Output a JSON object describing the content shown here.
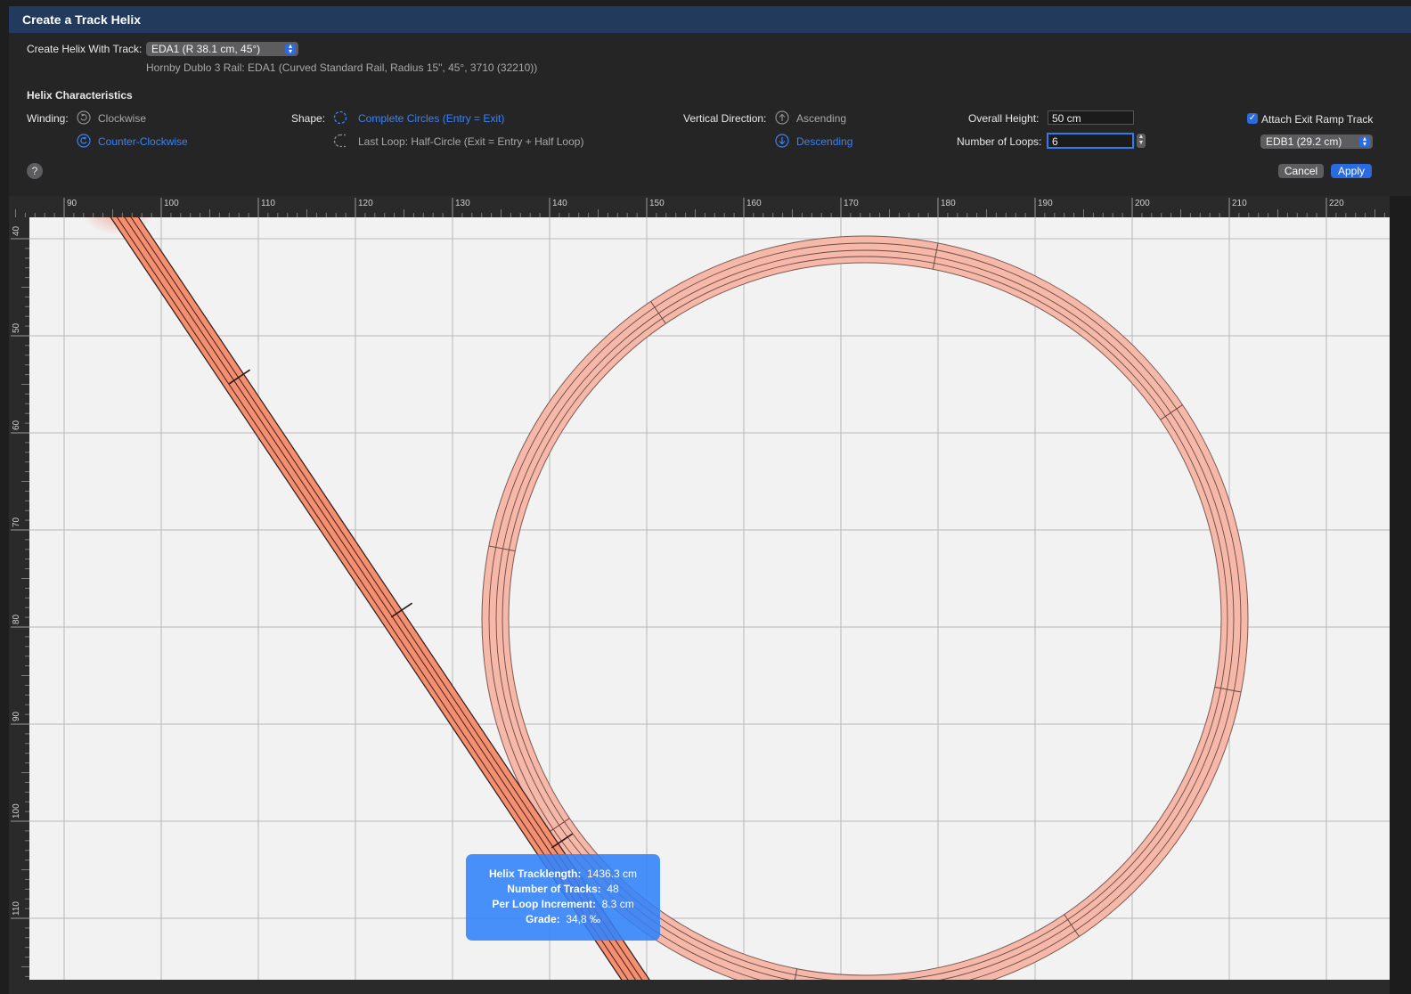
{
  "window": {
    "title": "Create a Track Helix"
  },
  "track": {
    "label": "Create Helix With Track:",
    "selected": "EDA1 (R 38.1 cm, 45°)",
    "description": "Hornby Dublo 3 Rail: EDA1  (Curved Standard Rail, Radius 15\", 45°, 3710 (32210))"
  },
  "helix": {
    "heading": "Helix Characteristics",
    "winding_label": "Winding:",
    "winding_clockwise": "Clockwise",
    "winding_counter": "Counter-Clockwise",
    "winding_selected": "Counter-Clockwise",
    "shape_label": "Shape:",
    "shape_complete": "Complete Circles (Entry = Exit)",
    "shape_half": "Last Loop: Half-Circle (Exit = Entry + Half Loop)",
    "shape_selected": "Complete Circles (Entry = Exit)",
    "direction_label": "Vertical Direction:",
    "direction_ascending": "Ascending",
    "direction_descending": "Descending",
    "direction_selected": "Descending",
    "height_label": "Overall Height:",
    "height_value": "50 cm",
    "loops_label": "Number of Loops:",
    "loops_value": "6",
    "attach_label": "Attach Exit Ramp Track",
    "attach_checked": true,
    "exit_track": "EDB1 (29.2 cm)"
  },
  "buttons": {
    "help": "?",
    "cancel": "Cancel",
    "apply": "Apply"
  },
  "ruler": {
    "top_labels": [
      "90",
      "100",
      "110",
      "120",
      "130",
      "140",
      "150",
      "160",
      "170",
      "180",
      "190",
      "200",
      "210",
      "220"
    ],
    "left_labels": [
      "40",
      "50",
      "60",
      "70",
      "80",
      "90",
      "100",
      "110"
    ]
  },
  "stats": {
    "length_label": "Helix Tracklength:",
    "length_value": "1436.3 cm",
    "tracks_label": "Number of Tracks:",
    "tracks_value": "48",
    "increment_label": "Per Loop Increment:",
    "increment_value": "8.3 cm",
    "grade_label": "Grade:",
    "grade_value": "34,8 ‰"
  },
  "colors": {
    "accent": "#2a6be0",
    "selected_text": "#3b82f6",
    "track_curve": "#f6b8a8",
    "track_straight": "#f58f70",
    "tooltip": "#2f82fa"
  }
}
